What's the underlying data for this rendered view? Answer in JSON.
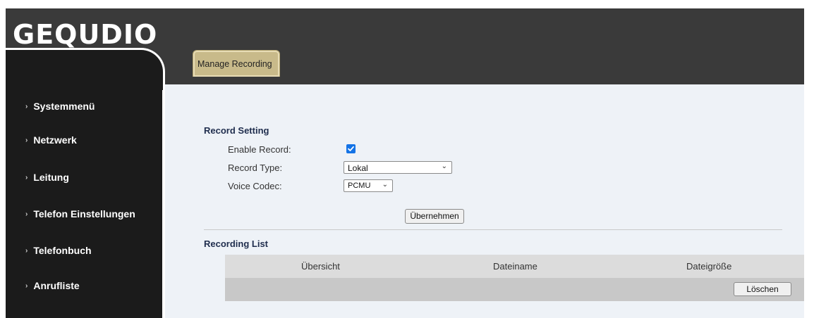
{
  "brand": {
    "logo": "GEQUDIO"
  },
  "sidebar": {
    "items": [
      {
        "label": "Systemmenü"
      },
      {
        "label": "Netzwerk"
      },
      {
        "label": "Leitung"
      },
      {
        "label": "Telefon Einstellungen"
      },
      {
        "label": "Telefonbuch"
      },
      {
        "label": "Anrufliste"
      }
    ]
  },
  "tabs": [
    {
      "label": "Manage Recording"
    }
  ],
  "record_setting": {
    "title": "Record Setting",
    "enable_record": {
      "label": "Enable Record:",
      "checked": true
    },
    "record_type": {
      "label": "Record Type:",
      "value": "Lokal"
    },
    "voice_codec": {
      "label": "Voice Codec:",
      "value": "PCMU"
    },
    "apply_label": "Übernehmen"
  },
  "recording_list": {
    "title": "Recording List",
    "columns": [
      "Übersicht",
      "Dateiname",
      "Dateigröße"
    ],
    "delete_label": "Löschen"
  },
  "colors": {
    "sidebar_bg": "#1b1b1b",
    "topbar_bg": "#3a3a3a",
    "content_bg": "#eef2f7",
    "tab_bg": "#c8ba8a",
    "accent": "#1473e6"
  }
}
